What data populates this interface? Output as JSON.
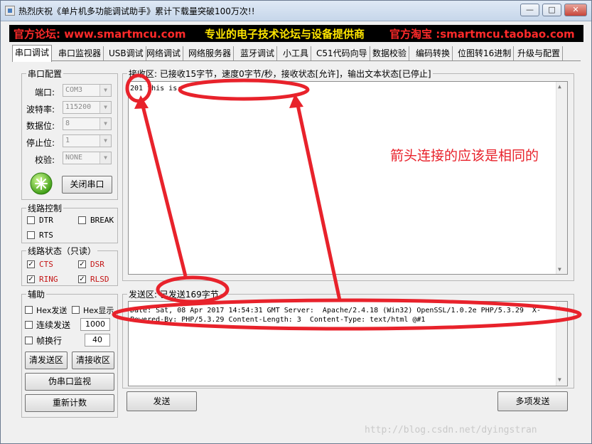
{
  "window": {
    "title": "热烈庆祝《单片机多功能调试助手》累计下载量突破100万次!!",
    "controls": {
      "minimize": "—",
      "maximize": "□",
      "close": "✕"
    }
  },
  "banner": {
    "left": "官方论坛: www.smartmcu.com",
    "center": "专业的电子技术论坛与设备提供商",
    "right": "官方淘宝 :smartmcu.taobao.com"
  },
  "tabs": [
    "串口调试",
    "串口监视器",
    "USB调试",
    "网络调试",
    "网络服务器",
    "蓝牙调试",
    "小工具",
    "C51代码向导",
    "数据校验",
    "编码转换",
    "位图转16进制",
    "升级与配置"
  ],
  "serial_config": {
    "title": "串口配置",
    "port_label": "端口:",
    "port_value": "COM3",
    "baud_label": "波特率:",
    "baud_value": "115200",
    "databits_label": "数据位:",
    "databits_value": "8",
    "stopbits_label": "停止位:",
    "stopbits_value": "1",
    "parity_label": "校验:",
    "parity_value": "NONE",
    "close_port_button": "关闭串口"
  },
  "line_control": {
    "title": "线路控制",
    "dtr": "DTR",
    "break": "BREAK",
    "rts": "RTS"
  },
  "line_status": {
    "title": "线路状态（只读）",
    "cts": "CTS",
    "dsr": "DSR",
    "ring": "RING",
    "rlsd": "RLSD"
  },
  "aux": {
    "title": "辅助",
    "hex_send": "Hex发送",
    "hex_display": "Hex显示",
    "continuous_send": "连续发送",
    "interval_value": "1000",
    "frame_newline": "帧换行",
    "frame_value": "40",
    "clear_send_button": "清发送区",
    "clear_recv_button": "清接收区",
    "pseudo_monitor_button": "伪串口监视",
    "reset_count_button": "重新计数"
  },
  "receive": {
    "header": "接收区: 已接收15字节，速度0字节/秒，接收状态[允许]，输出文本状态[已停止]",
    "content": "201 this is:"
  },
  "send": {
    "header": "发送区: 已发送169字节",
    "line1": "Date: Sat, 08 Apr 2017 14:54:31 GMT Server:  Apache/2.4.18 (Win32) OpenSSL/1.0.2e PHP/5.3.29  X-",
    "line2": "Powered-By: PHP/5.3.29 Content-Length: 3  Content-Type: text/html @#1",
    "send_button": "发送",
    "multi_send_button": "多项发送"
  },
  "annotation": {
    "note": "箭头连接的应该是相同的",
    "color": "#e8222b"
  },
  "watermark": "http://blog.csdn.net/dyingstran"
}
